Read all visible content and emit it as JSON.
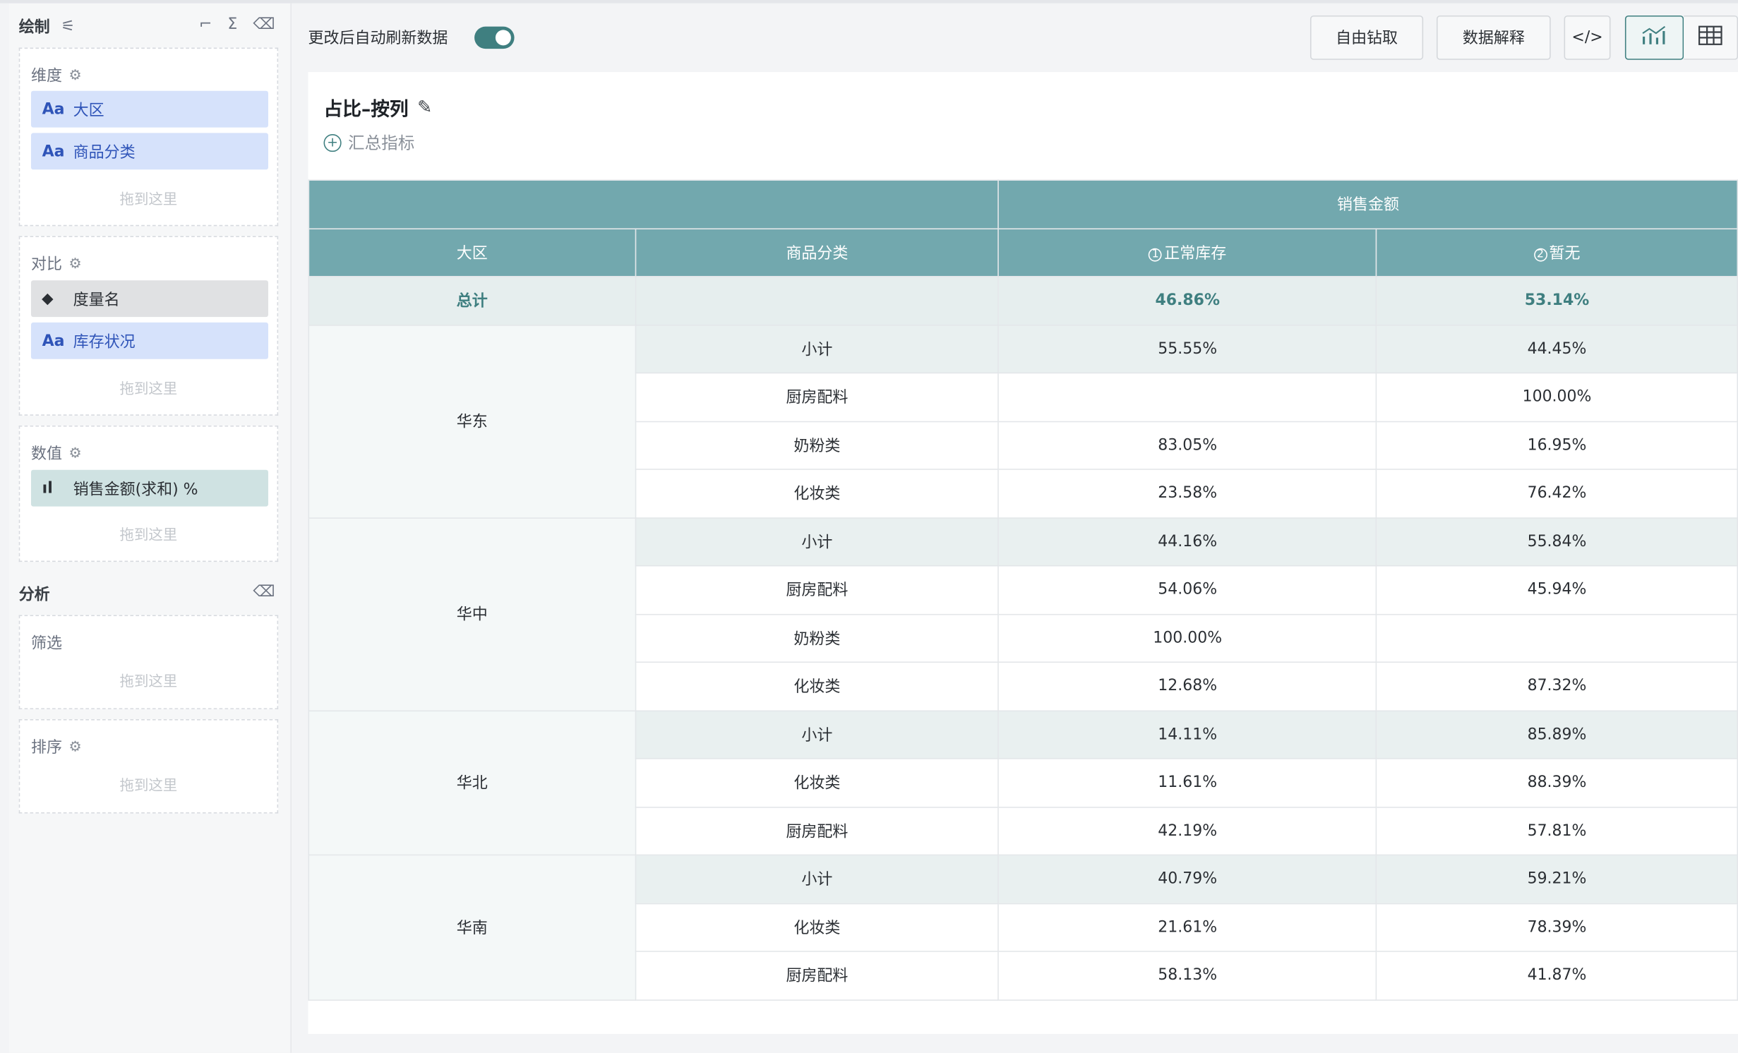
{
  "sidebar": {
    "draw_label": "绘制",
    "analysis_label": "分析",
    "dimension": {
      "title": "维度",
      "items": [
        "大区",
        "商品分类"
      ],
      "drop_hint": "拖到这里"
    },
    "compare": {
      "title": "对比",
      "measure_pill": "度量名",
      "items": [
        "库存状况"
      ],
      "drop_hint": "拖到这里"
    },
    "values": {
      "title": "数值",
      "items": [
        "销售金额(求和) %"
      ],
      "drop_hint": "拖到这里"
    },
    "filter": {
      "title": "筛选",
      "drop_hint": "拖到这里"
    },
    "sort": {
      "title": "排序",
      "drop_hint": "拖到这里"
    },
    "dim_tag": "Aa"
  },
  "toolbar": {
    "auto_refresh_label": "更改后自动刷新数据",
    "auto_refresh_on": true,
    "drill_button": "自由钻取",
    "explain_button": "数据解释",
    "code_button": "</>"
  },
  "chart": {
    "title": "占比–按列",
    "add_aggregate": "汇总指标"
  },
  "table": {
    "group_header": "销售金额",
    "col_region": "大区",
    "col_category": "商品分类",
    "col_normal_mark": "1",
    "col_normal": "正常库存",
    "col_none_mark": "2",
    "col_none": "暂无",
    "total": {
      "label": "总计",
      "normal": "46.86%",
      "none": "53.14%"
    },
    "regions": [
      {
        "name": "华东",
        "rows": [
          {
            "category": "小计",
            "normal": "55.55%",
            "none": "44.45%"
          },
          {
            "category": "厨房配料",
            "normal": "",
            "none": "100.00%"
          },
          {
            "category": "奶粉类",
            "normal": "83.05%",
            "none": "16.95%"
          },
          {
            "category": "化妆类",
            "normal": "23.58%",
            "none": "76.42%"
          }
        ]
      },
      {
        "name": "华中",
        "rows": [
          {
            "category": "小计",
            "normal": "44.16%",
            "none": "55.84%"
          },
          {
            "category": "厨房配料",
            "normal": "54.06%",
            "none": "45.94%"
          },
          {
            "category": "奶粉类",
            "normal": "100.00%",
            "none": ""
          },
          {
            "category": "化妆类",
            "normal": "12.68%",
            "none": "87.32%"
          }
        ]
      },
      {
        "name": "华北",
        "rows": [
          {
            "category": "小计",
            "normal": "14.11%",
            "none": "85.89%"
          },
          {
            "category": "化妆类",
            "normal": "11.61%",
            "none": "88.39%"
          },
          {
            "category": "厨房配料",
            "normal": "42.19%",
            "none": "57.81%"
          }
        ]
      },
      {
        "name": "华南",
        "rows": [
          {
            "category": "小计",
            "normal": "40.79%",
            "none": "59.21%"
          },
          {
            "category": "化妆类",
            "normal": "21.61%",
            "none": "78.39%"
          },
          {
            "category": "厨房配料",
            "normal": "58.13%",
            "none": "41.87%"
          }
        ]
      }
    ]
  }
}
